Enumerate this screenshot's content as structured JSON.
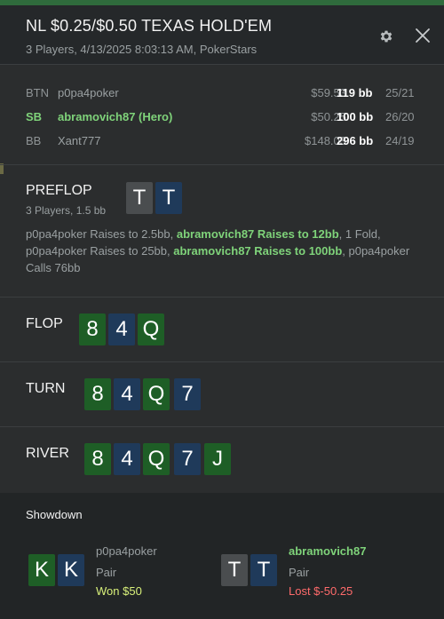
{
  "header": {
    "title": "NL $0.25/$0.50 TEXAS HOLD'EM",
    "subtitle": "3 Players, 4/13/2025 8:03:13 AM, PokerStars"
  },
  "icons": {
    "settings": "gear-icon",
    "close": "close-icon"
  },
  "players": [
    {
      "position": "BTN",
      "name": "p0pa4poker",
      "stack": "$59.53",
      "bb": "119 bb",
      "stat": "25/21"
    },
    {
      "position": "SB",
      "name": "abramovich87 (Hero)",
      "stack": "$50.25",
      "bb": "100 bb",
      "stat": "26/20"
    },
    {
      "position": "BB",
      "name": "Xant777",
      "stack": "$148.03",
      "bb": "296 bb",
      "stat": "24/19"
    }
  ],
  "preflop": {
    "title": "PREFLOP",
    "sub": "3 Players, 1.5 bb",
    "cards": [
      "T",
      "T"
    ],
    "actions": {
      "a1": "p0pa4poker Raises to 2.5bb, ",
      "a2": "abramovich87 Raises to 12bb",
      "a3": ", 1 Fold, p0pa4poker Raises to 25bb, ",
      "a4": "abramovich87 Raises to 100bb",
      "a5": ", p0pa4poker Calls 76bb"
    }
  },
  "flop": {
    "title": "FLOP",
    "cards": [
      "8",
      "4",
      "Q"
    ]
  },
  "turn": {
    "title": "TURN",
    "cards": [
      "8",
      "4",
      "Q",
      "7"
    ]
  },
  "river": {
    "title": "RIVER",
    "cards": [
      "8",
      "4",
      "Q",
      "7",
      "J"
    ]
  },
  "showdown": {
    "title": "Showdown",
    "players": [
      {
        "name": "p0pa4poker",
        "hand": "Pair",
        "result": "Won $50",
        "cards": [
          "K",
          "K"
        ]
      },
      {
        "name": "abramovich87",
        "hand": "Pair",
        "result": "Lost $-50.25",
        "cards": [
          "T",
          "T"
        ]
      }
    ]
  },
  "colors": {
    "accent_green": "#7fd37a",
    "lost_red": "#ff6b6b",
    "won_yellow": "#d8f07a",
    "card_green": "#1e5e26",
    "card_blue": "#1f3a5a",
    "card_grey": "#4a4d4f"
  }
}
